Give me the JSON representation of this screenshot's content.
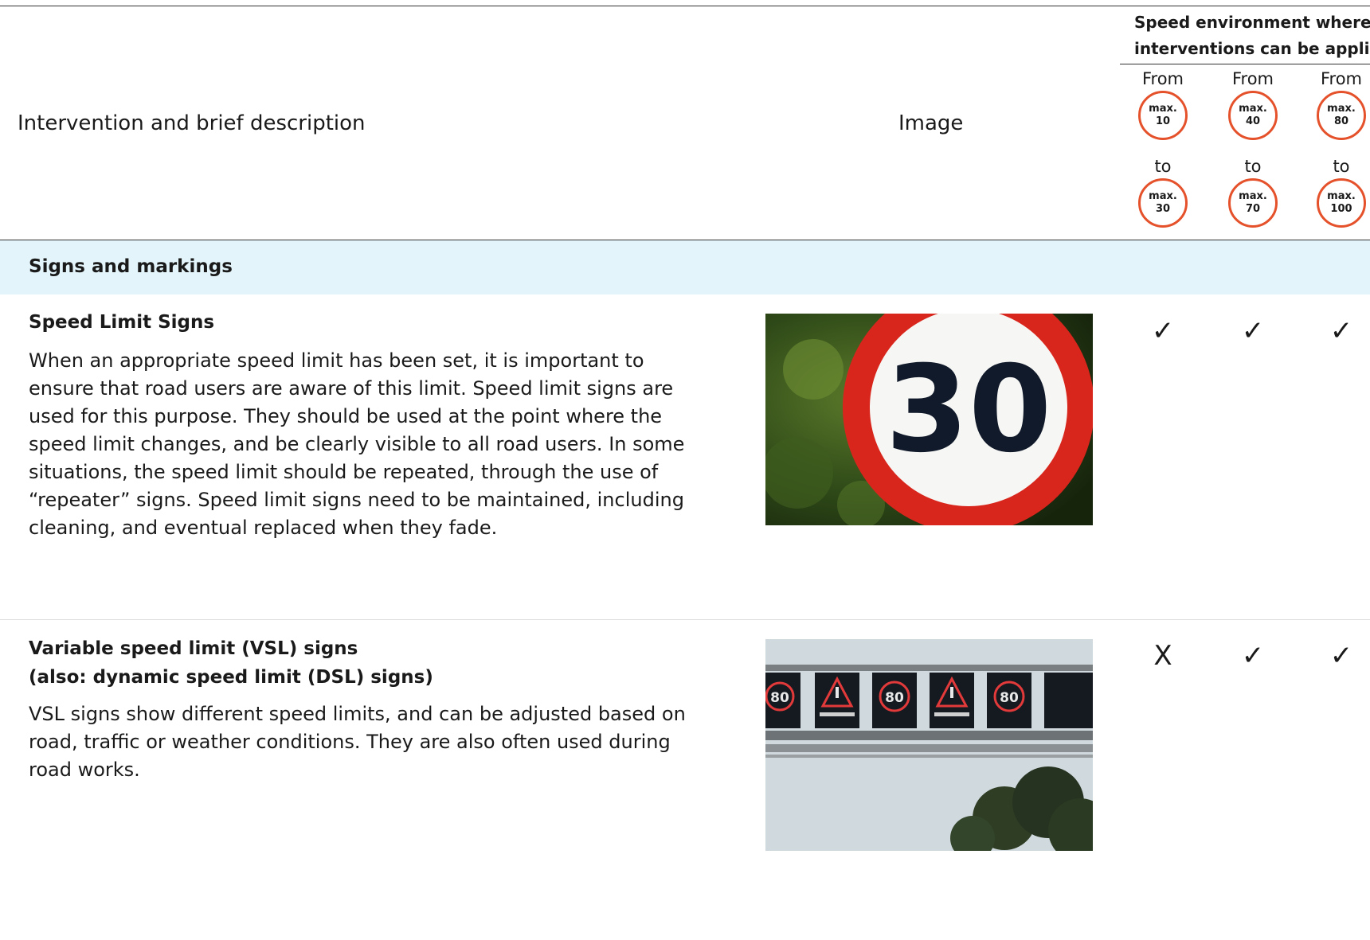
{
  "header": {
    "intervention_label": "Intervention and brief description",
    "image_label": "Image",
    "speed_group_line1": "Speed environment where",
    "speed_group_line2": "interventions can be applied",
    "speed_columns": [
      {
        "from_word": "From",
        "from_max": "max.",
        "from_val": "10",
        "to_word": "to",
        "to_max": "max.",
        "to_val": "30"
      },
      {
        "from_word": "From",
        "from_max": "max.",
        "from_val": "40",
        "to_word": "to",
        "to_max": "max.",
        "to_val": "70"
      },
      {
        "from_word": "From",
        "from_max": "max.",
        "from_val": "80",
        "to_word": "to",
        "to_max": "max.",
        "to_val": "100"
      }
    ]
  },
  "section": {
    "title": "Signs and markings"
  },
  "rows": [
    {
      "title": "Speed Limit Signs",
      "description": "When an appropriate speed limit has been set, it is important to ensure that road users are aware of this limit. Speed limit signs are used for this purpose. They should be used at the point where the speed limit changes, and be clearly visible to all road users. In some situations, the speed limit should be repeated, through the use of “repeater” signs. Speed limit signs need to be maintained, including cleaning, and eventual replaced when they fade.",
      "image_sign_text": "30",
      "marks": [
        "✓",
        "✓",
        "✓"
      ]
    },
    {
      "title": "Variable speed limit (VSL) signs",
      "subtitle": "(also: dynamic speed limit (DSL) signs)",
      "description": "VSL signs show different speed limits, and can be adjusted based on road, traffic or weather conditions. They are also often used during road works.",
      "image_sign_text": "80",
      "marks": [
        "X",
        "✓",
        "✓"
      ]
    }
  ],
  "colors": {
    "badge_border": "#e4512a",
    "section_band": "#e3f5fa",
    "sign_red": "#d9261c"
  }
}
